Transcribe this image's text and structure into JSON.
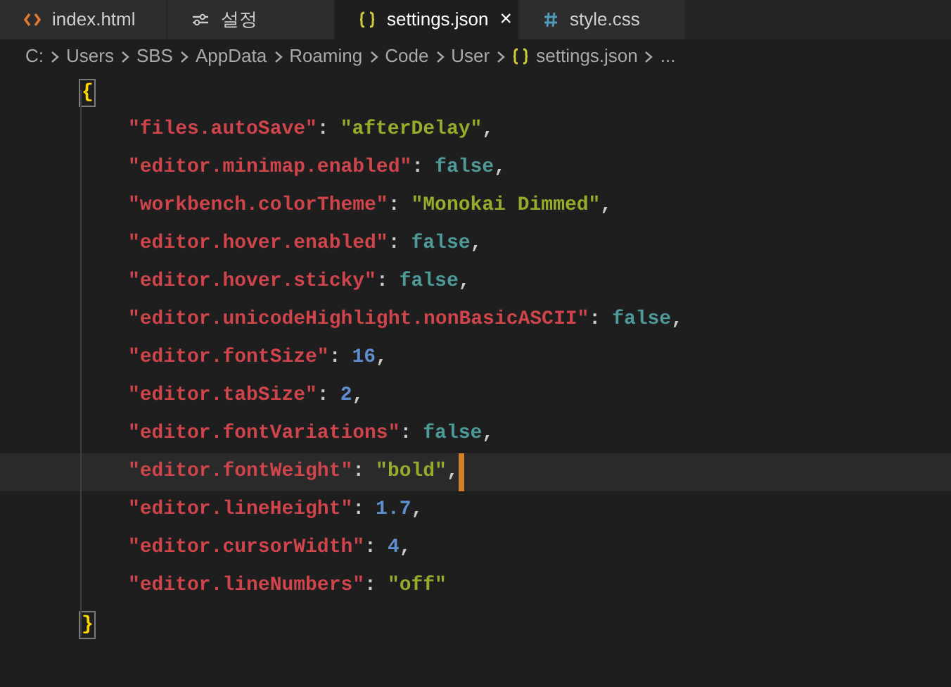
{
  "tabs": [
    {
      "label": "index.html",
      "kind": "html",
      "selected": false
    },
    {
      "label": "설정",
      "kind": "settings",
      "selected": false
    },
    {
      "label": "settings.json",
      "kind": "json",
      "selected": true,
      "close": "×"
    },
    {
      "label": "style.css",
      "kind": "css",
      "selected": false
    }
  ],
  "breadcrumb": [
    {
      "label": "C:"
    },
    {
      "label": "Users"
    },
    {
      "label": "SBS"
    },
    {
      "label": "AppData"
    },
    {
      "label": "Roaming"
    },
    {
      "label": "Code"
    },
    {
      "label": "User"
    },
    {
      "label": "settings.json",
      "kind": "json"
    },
    {
      "label": "..."
    }
  ],
  "lines": [
    {
      "kind": "brace",
      "text": "{",
      "matched": true,
      "current": false
    },
    {
      "kind": "string",
      "key": "\"files.autoSave\"",
      "colon": ":",
      "value": "\"afterDelay\"",
      "comma": ",",
      "current": false
    },
    {
      "kind": "keyword",
      "key": "\"editor.minimap.enabled\"",
      "colon": ":",
      "value": "false",
      "comma": ",",
      "current": false
    },
    {
      "kind": "string",
      "key": "\"workbench.colorTheme\"",
      "colon": ":",
      "value": "\"Monokai Dimmed\"",
      "comma": ",",
      "current": false
    },
    {
      "kind": "keyword",
      "key": "\"editor.hover.enabled\"",
      "colon": ":",
      "value": "false",
      "comma": ",",
      "current": false
    },
    {
      "kind": "keyword",
      "key": "\"editor.hover.sticky\"",
      "colon": ":",
      "value": "false",
      "comma": ",",
      "current": false
    },
    {
      "kind": "keyword",
      "key": "\"editor.unicodeHighlight.nonBasicASCII\"",
      "colon": ":",
      "value": "false",
      "comma": ",",
      "current": false
    },
    {
      "kind": "number",
      "key": "\"editor.fontSize\"",
      "colon": ":",
      "value": "16",
      "comma": ",",
      "current": false
    },
    {
      "kind": "number",
      "key": "\"editor.tabSize\"",
      "colon": ":",
      "value": "2",
      "comma": ",",
      "current": false
    },
    {
      "kind": "keyword",
      "key": "\"editor.fontVariations\"",
      "colon": ":",
      "value": "false",
      "comma": ",",
      "current": false
    },
    {
      "kind": "string",
      "key": "\"editor.fontWeight\"",
      "colon": ":",
      "value": "\"bold\"",
      "comma": ",",
      "current": true
    },
    {
      "kind": "number",
      "key": "\"editor.lineHeight\"",
      "colon": ":",
      "value": "1.7",
      "comma": ",",
      "current": false
    },
    {
      "kind": "number",
      "key": "\"editor.cursorWidth\"",
      "colon": ":",
      "value": "4",
      "comma": ",",
      "current": false
    },
    {
      "kind": "string",
      "key": "\"editor.lineNumbers\"",
      "colon": ":",
      "value": "\"off\"",
      "current": false
    },
    {
      "kind": "brace",
      "text": "}",
      "matched": true,
      "current": false
    }
  ]
}
